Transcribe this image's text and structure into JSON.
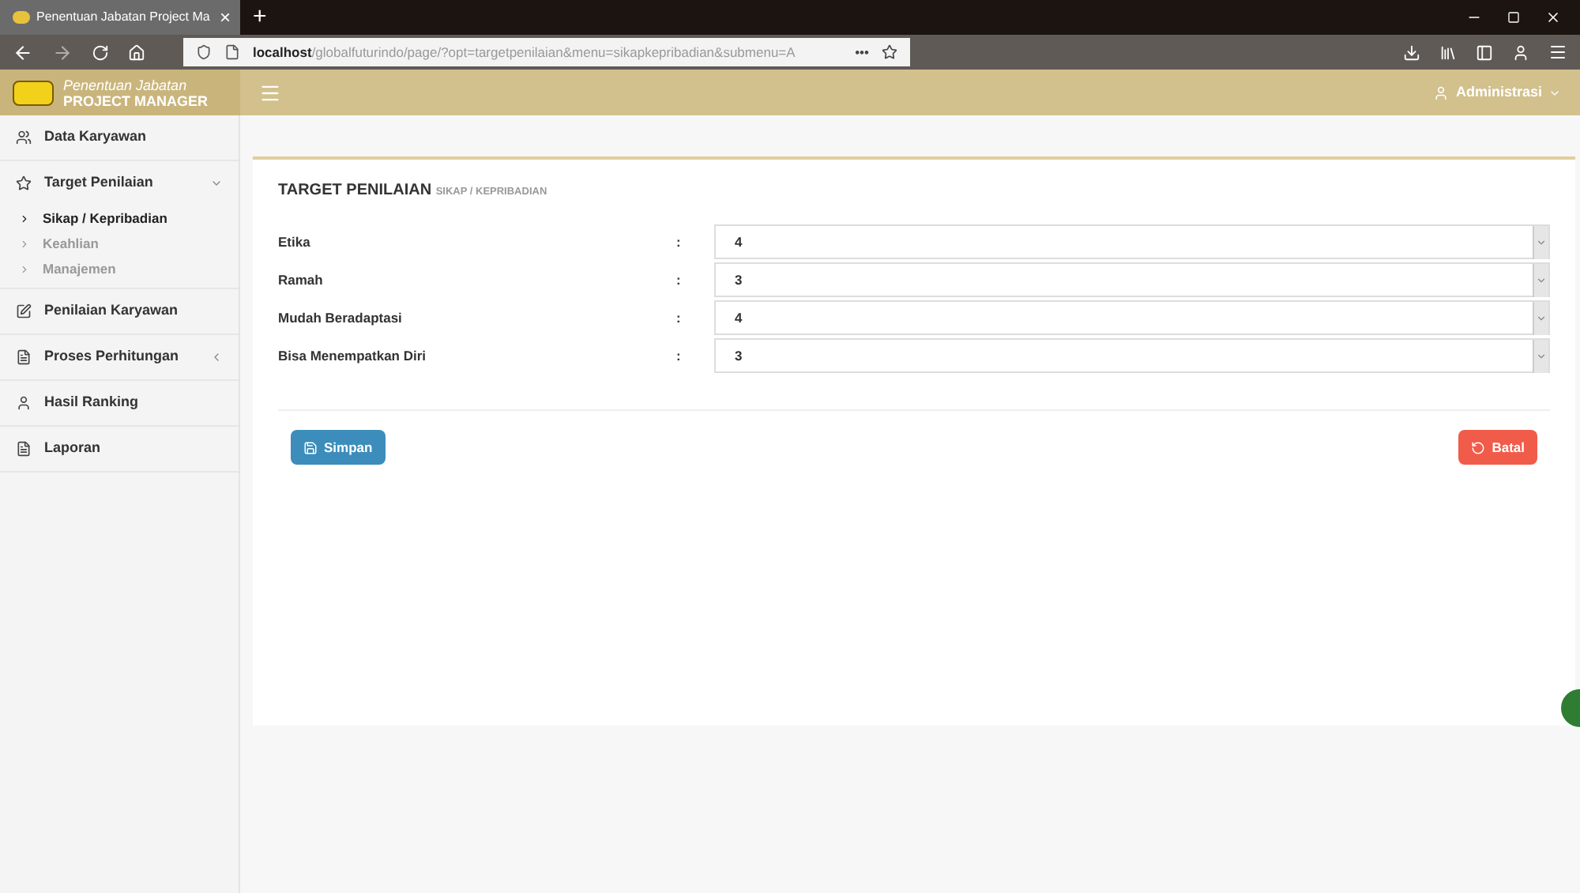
{
  "browser": {
    "tab_title": "Penentuan Jabatan Project Ma",
    "tab_close": "×",
    "new_tab": "+",
    "url_host": "localhost",
    "url_path": "/globalfuturindo/page/?opt=targetpenilaian&menu=sikapkepribadian&submenu=A",
    "page_actions": "•••"
  },
  "header": {
    "logo_line1": "Penentuan Jabatan",
    "logo_line2": "PROJECT MANAGER",
    "user": "Administrasi"
  },
  "sidebar": {
    "items": [
      {
        "label": "Data Karyawan",
        "kind": "users"
      },
      {
        "label": "Target Penilaian",
        "kind": "star",
        "expanded": true,
        "children": [
          {
            "label": "Sikap / Kepribadian",
            "selected": true
          },
          {
            "label": "Keahlian",
            "selected": false
          },
          {
            "label": "Manajemen",
            "selected": false
          }
        ]
      },
      {
        "label": "Penilaian Karyawan",
        "kind": "edit"
      },
      {
        "label": "Proses Perhitungan",
        "kind": "file",
        "expanded": false
      },
      {
        "label": "Hasil Ranking",
        "kind": "user"
      },
      {
        "label": "Laporan",
        "kind": "file"
      }
    ]
  },
  "form": {
    "title": "TARGET PENILAIAN",
    "subtitle": "SIKAP / KEPRIBADIAN",
    "fields": [
      {
        "label": "Etika",
        "separator": ":",
        "value": "4"
      },
      {
        "label": "Ramah",
        "separator": ":",
        "value": "3"
      },
      {
        "label": "Mudah Beradaptasi",
        "separator": ":",
        "value": "4"
      },
      {
        "label": "Bisa Menempatkan Diri",
        "separator": ":",
        "value": "3"
      }
    ],
    "save_button": "Simpan",
    "cancel_button": "Batal"
  }
}
